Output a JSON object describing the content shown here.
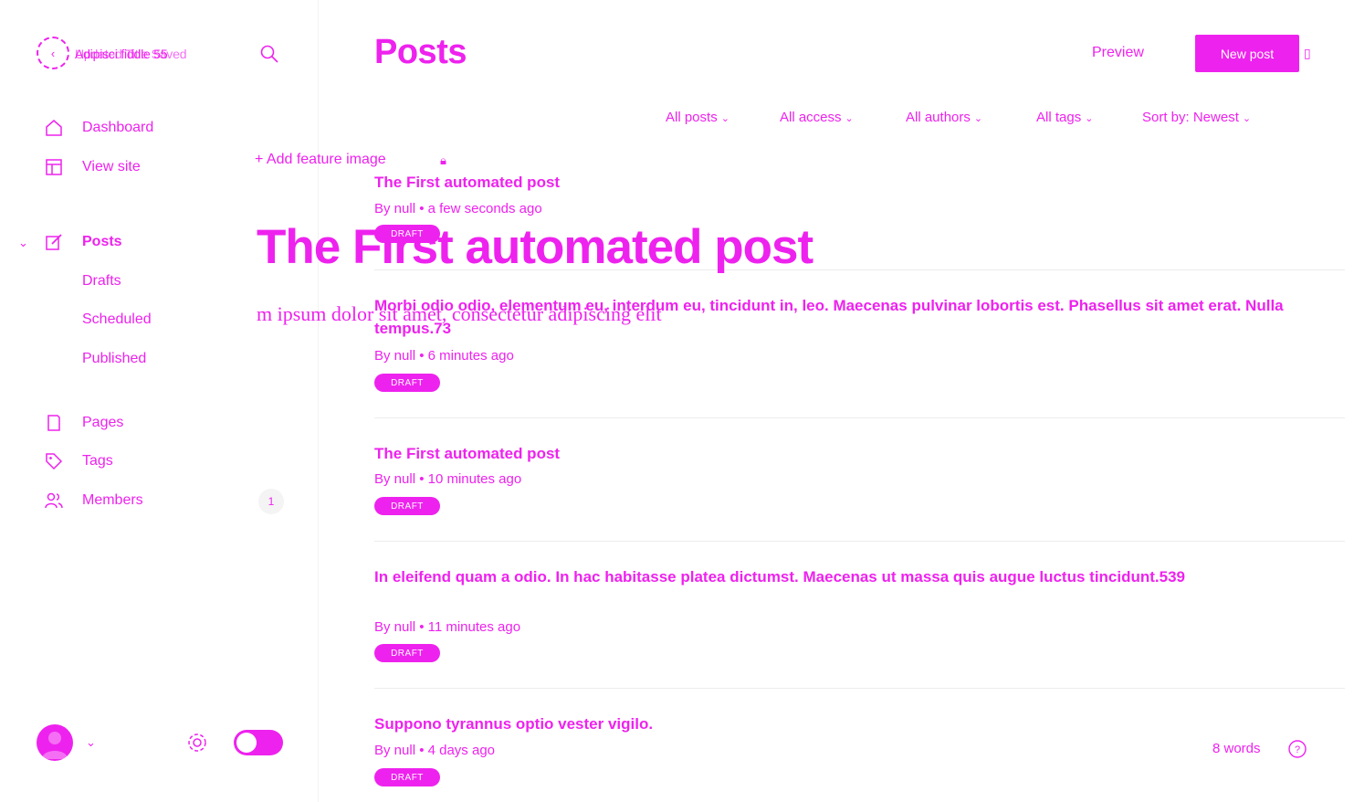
{
  "site": {
    "title": "Adipisci fiddle 55",
    "overlay_text": "Updated Title Saved"
  },
  "nav": {
    "dashboard": "Dashboard",
    "view_site": "View site",
    "posts": "Posts",
    "drafts": "Drafts",
    "scheduled": "Scheduled",
    "published": "Published",
    "pages": "Pages",
    "tags": "Tags",
    "members": "Members",
    "members_count": "1"
  },
  "header": {
    "title": "Posts",
    "preview": "Preview",
    "new_post": "New post"
  },
  "filters": {
    "type": "All posts",
    "access": "All access",
    "authors": "All authors",
    "tags": "All tags",
    "sort": "Sort by: Newest"
  },
  "editor": {
    "add_feature_image": "+ Add feature image",
    "headline": "The First automated post",
    "body": "m ipsum dolor sit amet, consectetur adipiscing elit",
    "word_count": "8 words"
  },
  "posts": [
    {
      "title": "The First automated post",
      "meta": "By null • a few seconds ago",
      "status": "DRAFT"
    },
    {
      "title": "Morbi odio odio, elementum eu, interdum eu, tincidunt in, leo. Maecenas pulvinar lobortis est. Phasellus sit amet erat. Nulla tempus.73",
      "meta": "By null • 6 minutes ago",
      "status": "DRAFT"
    },
    {
      "title": "The First automated post",
      "meta": "By null • 10 minutes ago",
      "status": "DRAFT"
    },
    {
      "title": "In eleifend quam a odio. In hac habitasse platea dictumst. Maecenas ut massa quis augue luctus tincidunt.539",
      "meta": "By null • 11 minutes ago",
      "status": "DRAFT"
    },
    {
      "title": "Suppono tyrannus optio vester vigilo.",
      "meta": "By null • 4 days ago",
      "status": "DRAFT"
    }
  ],
  "colors": {
    "accent": "#ee22ee",
    "divider": "#ececec",
    "background": "#ffffff"
  }
}
